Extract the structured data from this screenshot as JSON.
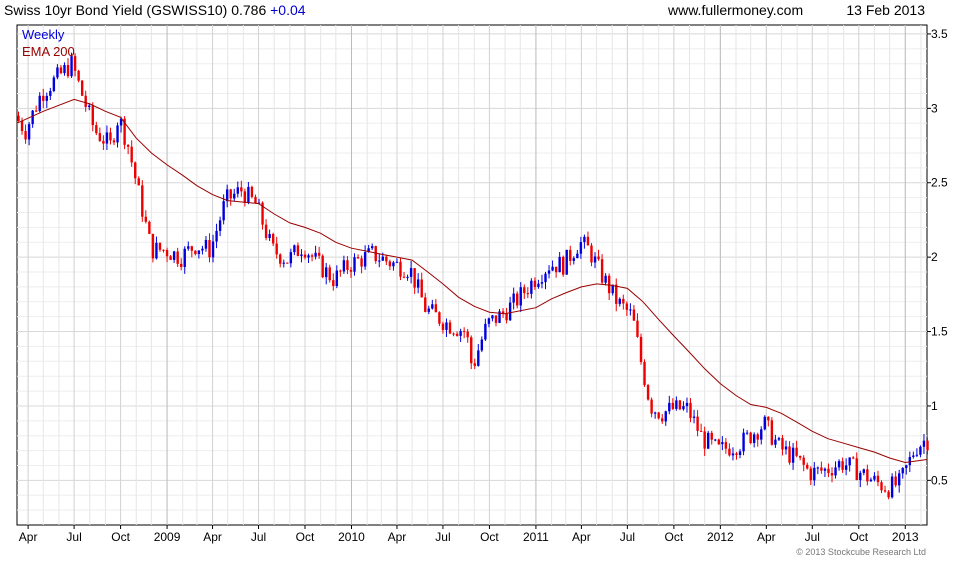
{
  "header": {
    "title": "Swiss 10yr Bond Yield (GSWISS10) 0.786",
    "change": "+0.04",
    "site": "www.fullermoney.com",
    "date": "13 Feb 2013"
  },
  "legend": {
    "weekly": "Weekly",
    "ema": "EMA 200"
  },
  "footer": {
    "credit": "© 2013 Stockcube Research Ltd"
  },
  "colors": {
    "up": "#0000dd",
    "down": "#ee0000",
    "ema": "#990000",
    "grid": "#d8d8d8",
    "change": "#0000cc"
  },
  "chart_data": {
    "type": "candlestick",
    "interval": "weekly",
    "ylim": [
      0.2,
      3.56
    ],
    "y_ticks": [
      0.5,
      1,
      1.5,
      2,
      2.5,
      3,
      3.5
    ],
    "y_tick_labels": [
      "0.5",
      "1",
      "1.5",
      "2",
      "2.5",
      "3",
      "3.5"
    ],
    "x_range": [
      "2008-03-10",
      "2013-02-13"
    ],
    "x_ticks": [
      {
        "date": "2008-04-01",
        "label": "Apr",
        "major": false
      },
      {
        "date": "2008-07-01",
        "label": "Jul",
        "major": false
      },
      {
        "date": "2008-10-01",
        "label": "Oct",
        "major": false
      },
      {
        "date": "2009-01-01",
        "label": "2009",
        "major": true
      },
      {
        "date": "2009-04-01",
        "label": "Apr",
        "major": false
      },
      {
        "date": "2009-07-01",
        "label": "Jul",
        "major": false
      },
      {
        "date": "2009-10-01",
        "label": "Oct",
        "major": false
      },
      {
        "date": "2010-01-01",
        "label": "2010",
        "major": true
      },
      {
        "date": "2010-04-01",
        "label": "Apr",
        "major": false
      },
      {
        "date": "2010-07-01",
        "label": "Jul",
        "major": false
      },
      {
        "date": "2010-10-01",
        "label": "Oct",
        "major": false
      },
      {
        "date": "2011-01-01",
        "label": "2011",
        "major": true
      },
      {
        "date": "2011-04-01",
        "label": "Apr",
        "major": false
      },
      {
        "date": "2011-07-01",
        "label": "Jul",
        "major": false
      },
      {
        "date": "2011-10-01",
        "label": "Oct",
        "major": false
      },
      {
        "date": "2012-01-01",
        "label": "2012",
        "major": true
      },
      {
        "date": "2012-04-01",
        "label": "Apr",
        "major": false
      },
      {
        "date": "2012-07-01",
        "label": "Jul",
        "major": false
      },
      {
        "date": "2012-10-01",
        "label": "Oct",
        "major": false
      },
      {
        "date": "2013-01-01",
        "label": "2013",
        "major": true
      }
    ],
    "price_path": [
      [
        "2008-03-10",
        2.95
      ],
      [
        "2008-03-31",
        2.85
      ],
      [
        "2008-05-01",
        3.1
      ],
      [
        "2008-06-15",
        3.25
      ],
      [
        "2008-07-01",
        3.3
      ],
      [
        "2008-07-25",
        3.05
      ],
      [
        "2008-08-15",
        2.85
      ],
      [
        "2008-09-15",
        2.75
      ],
      [
        "2008-10-01",
        2.95
      ],
      [
        "2008-10-20",
        2.75
      ],
      [
        "2008-11-15",
        2.35
      ],
      [
        "2008-12-05",
        2.05
      ],
      [
        "2009-01-01",
        2.05
      ],
      [
        "2009-02-01",
        2.0
      ],
      [
        "2009-03-01",
        2.08
      ],
      [
        "2009-04-01",
        2.05
      ],
      [
        "2009-05-01",
        2.38
      ],
      [
        "2009-06-01",
        2.45
      ],
      [
        "2009-07-01",
        2.35
      ],
      [
        "2009-08-01",
        2.05
      ],
      [
        "2009-09-01",
        1.98
      ],
      [
        "2009-10-01",
        2.08
      ],
      [
        "2009-11-01",
        1.95
      ],
      [
        "2009-12-01",
        1.85
      ],
      [
        "2010-01-01",
        1.95
      ],
      [
        "2010-02-15",
        2.02
      ],
      [
        "2010-04-01",
        1.95
      ],
      [
        "2010-05-01",
        1.92
      ],
      [
        "2010-06-01",
        1.65
      ],
      [
        "2010-07-15",
        1.55
      ],
      [
        "2010-08-20",
        1.5
      ],
      [
        "2010-09-01",
        1.25
      ],
      [
        "2010-09-15",
        1.4
      ],
      [
        "2010-10-01",
        1.55
      ],
      [
        "2010-11-01",
        1.62
      ],
      [
        "2010-12-01",
        1.72
      ],
      [
        "2011-01-01",
        1.85
      ],
      [
        "2011-02-01",
        1.95
      ],
      [
        "2011-03-01",
        1.95
      ],
      [
        "2011-04-01",
        2.1
      ],
      [
        "2011-04-20",
        2.05
      ],
      [
        "2011-05-15",
        1.88
      ],
      [
        "2011-06-15",
        1.7
      ],
      [
        "2011-07-15",
        1.6
      ],
      [
        "2011-08-01",
        1.3
      ],
      [
        "2011-08-20",
        1.0
      ],
      [
        "2011-09-10",
        0.95
      ],
      [
        "2011-10-01",
        0.98
      ],
      [
        "2011-11-01",
        0.98
      ],
      [
        "2011-12-01",
        0.78
      ],
      [
        "2012-01-01",
        0.7
      ],
      [
        "2012-02-15",
        0.75
      ],
      [
        "2012-04-01",
        0.88
      ],
      [
        "2012-05-01",
        0.72
      ],
      [
        "2012-06-01",
        0.65
      ],
      [
        "2012-07-01",
        0.55
      ],
      [
        "2012-08-01",
        0.57
      ],
      [
        "2012-09-01",
        0.62
      ],
      [
        "2012-10-01",
        0.57
      ],
      [
        "2012-11-01",
        0.5
      ],
      [
        "2012-12-01",
        0.45
      ],
      [
        "2012-12-25",
        0.48
      ],
      [
        "2013-01-10",
        0.6
      ],
      [
        "2013-01-25",
        0.72
      ],
      [
        "2013-02-13",
        0.77
      ]
    ],
    "ema_200": [
      [
        "2008-03-10",
        2.9
      ],
      [
        "2008-05-01",
        2.98
      ],
      [
        "2008-07-01",
        3.06
      ],
      [
        "2008-08-01",
        3.03
      ],
      [
        "2008-09-01",
        2.98
      ],
      [
        "2008-10-01",
        2.94
      ],
      [
        "2008-11-01",
        2.8
      ],
      [
        "2008-12-01",
        2.7
      ],
      [
        "2009-01-01",
        2.62
      ],
      [
        "2009-02-01",
        2.55
      ],
      [
        "2009-03-01",
        2.48
      ],
      [
        "2009-04-01",
        2.42
      ],
      [
        "2009-05-01",
        2.38
      ],
      [
        "2009-06-01",
        2.37
      ],
      [
        "2009-07-01",
        2.36
      ],
      [
        "2009-08-01",
        2.29
      ],
      [
        "2009-09-01",
        2.23
      ],
      [
        "2009-10-01",
        2.2
      ],
      [
        "2009-11-01",
        2.16
      ],
      [
        "2009-12-01",
        2.1
      ],
      [
        "2010-01-01",
        2.06
      ],
      [
        "2010-02-01",
        2.04
      ],
      [
        "2010-03-01",
        2.02
      ],
      [
        "2010-04-01",
        2.0
      ],
      [
        "2010-05-01",
        1.98
      ],
      [
        "2010-06-01",
        1.9
      ],
      [
        "2010-07-01",
        1.82
      ],
      [
        "2010-08-01",
        1.73
      ],
      [
        "2010-09-01",
        1.67
      ],
      [
        "2010-10-01",
        1.63
      ],
      [
        "2010-11-01",
        1.62
      ],
      [
        "2010-12-01",
        1.64
      ],
      [
        "2011-01-01",
        1.66
      ],
      [
        "2011-02-01",
        1.72
      ],
      [
        "2011-03-01",
        1.76
      ],
      [
        "2011-04-01",
        1.8
      ],
      [
        "2011-05-01",
        1.82
      ],
      [
        "2011-06-01",
        1.81
      ],
      [
        "2011-07-01",
        1.79
      ],
      [
        "2011-08-01",
        1.7
      ],
      [
        "2011-09-01",
        1.58
      ],
      [
        "2011-10-01",
        1.47
      ],
      [
        "2011-11-01",
        1.36
      ],
      [
        "2011-12-01",
        1.25
      ],
      [
        "2012-01-01",
        1.15
      ],
      [
        "2012-02-01",
        1.07
      ],
      [
        "2012-03-01",
        1.01
      ],
      [
        "2012-04-01",
        0.99
      ],
      [
        "2012-05-01",
        0.95
      ],
      [
        "2012-06-01",
        0.89
      ],
      [
        "2012-07-01",
        0.83
      ],
      [
        "2012-08-01",
        0.78
      ],
      [
        "2012-09-01",
        0.75
      ],
      [
        "2012-10-01",
        0.72
      ],
      [
        "2012-11-01",
        0.69
      ],
      [
        "2012-12-01",
        0.65
      ],
      [
        "2013-01-01",
        0.62
      ],
      [
        "2013-02-13",
        0.64
      ]
    ]
  }
}
